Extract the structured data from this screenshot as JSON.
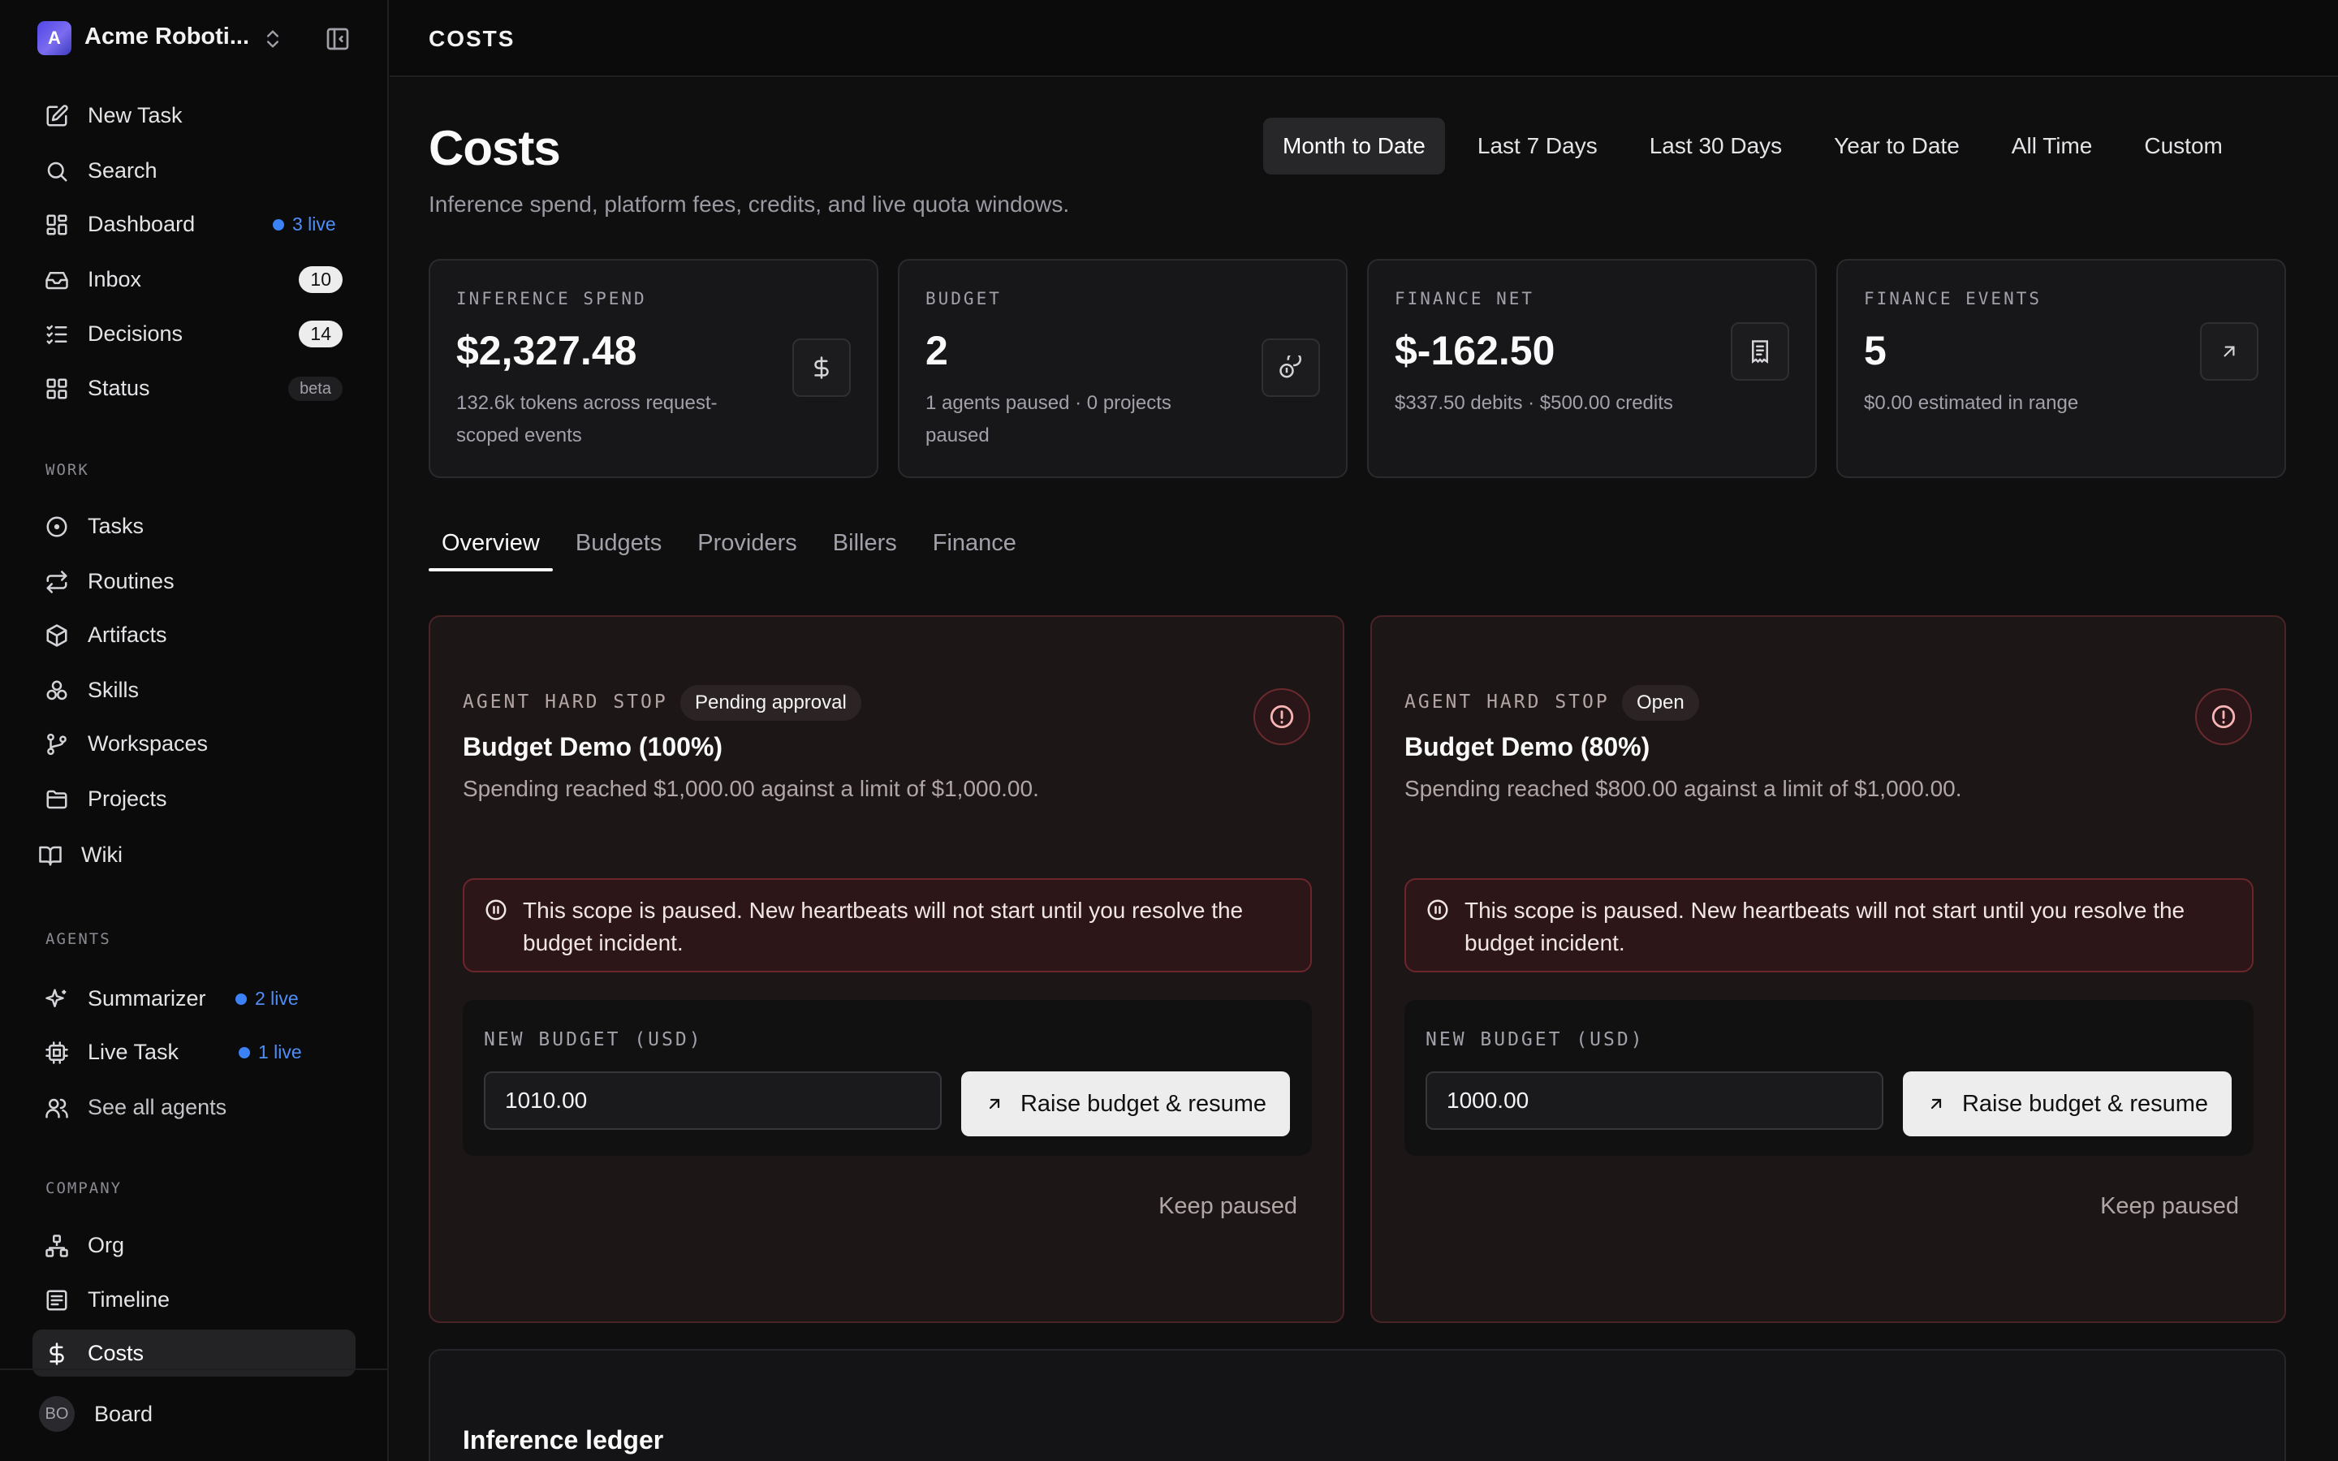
{
  "org": {
    "name": "Acme Roboti...",
    "avatar_letter": "A"
  },
  "sidebar": {
    "primary": [
      {
        "label": "New Task",
        "icon": "edit-icon"
      },
      {
        "label": "Search",
        "icon": "search-icon"
      },
      {
        "label": "Dashboard",
        "icon": "dashboard-icon",
        "live": "3 live"
      },
      {
        "label": "Inbox",
        "icon": "inbox-icon",
        "count": "10"
      },
      {
        "label": "Decisions",
        "icon": "checklist-icon",
        "count": "14"
      },
      {
        "label": "Status",
        "icon": "grid-icon",
        "badge": "beta"
      }
    ],
    "work_label": "WORK",
    "work": [
      {
        "label": "Tasks",
        "icon": "circle-dot-icon"
      },
      {
        "label": "Routines",
        "icon": "repeat-icon"
      },
      {
        "label": "Artifacts",
        "icon": "package-icon"
      },
      {
        "label": "Skills",
        "icon": "boxes-icon"
      },
      {
        "label": "Workspaces",
        "icon": "git-branch-icon"
      },
      {
        "label": "Projects",
        "icon": "folder-icon"
      },
      {
        "label": "Wiki",
        "icon": "book-icon"
      }
    ],
    "agents_label": "AGENTS",
    "agents": [
      {
        "label": "Summarizer",
        "icon": "sparkles-icon",
        "live": "2 live"
      },
      {
        "label": "Live Task",
        "icon": "cpu-icon",
        "live": "1 live"
      },
      {
        "label": "See all agents",
        "icon": "users-icon"
      }
    ],
    "company_label": "COMPANY",
    "company": [
      {
        "label": "Org",
        "icon": "org-chart-icon"
      },
      {
        "label": "Timeline",
        "icon": "list-icon"
      },
      {
        "label": "Costs",
        "icon": "dollar-icon",
        "active": true
      }
    ],
    "user": {
      "initials": "BO",
      "name": "Board"
    }
  },
  "topbar": {
    "crumb": "COSTS"
  },
  "page": {
    "title": "Costs",
    "subtitle": "Inference spend, platform fees, credits, and live quota windows."
  },
  "range_tabs": [
    {
      "label": "Month to Date",
      "active": true
    },
    {
      "label": "Last 7 Days"
    },
    {
      "label": "Last 30 Days"
    },
    {
      "label": "Year to Date"
    },
    {
      "label": "All Time"
    },
    {
      "label": "Custom"
    }
  ],
  "stats": [
    {
      "label": "INFERENCE SPEND",
      "value": "$2,327.48",
      "note": "132.6k tokens across request-scoped events",
      "icon": "dollar-icon"
    },
    {
      "label": "BUDGET",
      "value": "2",
      "note": "1 agents paused · 0 projects paused",
      "icon": "coins-icon"
    },
    {
      "label": "FINANCE NET",
      "value": "$-162.50",
      "note": "$337.50 debits · $500.00 credits",
      "icon": "receipt-icon"
    },
    {
      "label": "FINANCE EVENTS",
      "value": "5",
      "note": "$0.00 estimated in range",
      "icon": "arrow-up-right-icon"
    }
  ],
  "section_tabs": [
    {
      "label": "Overview",
      "active": true
    },
    {
      "label": "Budgets"
    },
    {
      "label": "Providers"
    },
    {
      "label": "Billers"
    },
    {
      "label": "Finance"
    }
  ],
  "incidents": [
    {
      "kicker": "AGENT HARD STOP",
      "status": "Pending approval",
      "title": "Budget Demo (100%)",
      "description": "Spending reached $1,000.00 against a limit of $1,000.00.",
      "banner": "This scope is paused. New heartbeats will not start until you resolve the budget incident.",
      "budget_label": "NEW BUDGET (USD)",
      "budget_value": "1010.00",
      "raise_label": "Raise budget & resume",
      "keep_label": "Keep paused"
    },
    {
      "kicker": "AGENT HARD STOP",
      "status": "Open",
      "title": "Budget Demo (80%)",
      "description": "Spending reached $800.00 against a limit of $1,000.00.",
      "banner": "This scope is paused. New heartbeats will not start until you resolve the budget incident.",
      "budget_label": "NEW BUDGET (USD)",
      "budget_value": "1000.00",
      "raise_label": "Raise budget & resume",
      "keep_label": "Keep paused"
    }
  ],
  "ledger": {
    "title": "Inference ledger"
  },
  "colors": {
    "accent_live": "#3b82f6",
    "incident_border": "#4a2326",
    "background": "#0f0f10"
  }
}
